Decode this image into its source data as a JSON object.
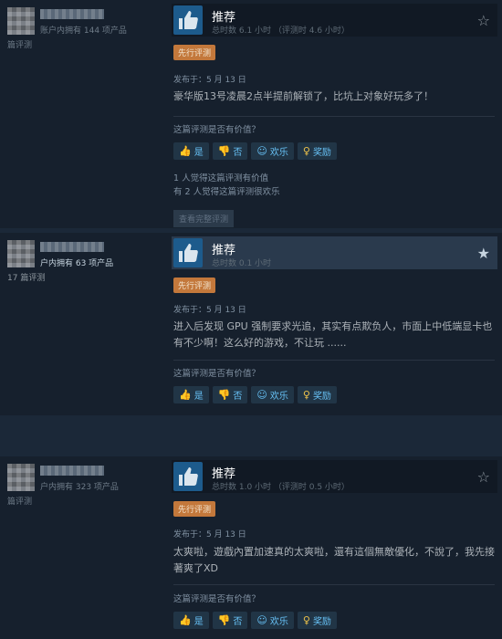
{
  "reviews": [
    {
      "products": "账户内拥有 144 项产品",
      "reviews_count": "篇评测",
      "title": "推荐",
      "hours": "总时数 6.1 小时 （评测时 4.6 小时）",
      "badge": "先行评测",
      "posted": "发布于：5 月 13 日",
      "body": "豪华版13号凌晨2点半提前解锁了，比坑上对象好玩多了！",
      "helpful_question": "这篇评测是否有价值？",
      "stats": [
        "1 人觉得这篇评测有价值",
        "有 2 人觉得这篇评测很欢乐"
      ],
      "read_more": "查看完整评测"
    },
    {
      "products": "户内拥有 63 项产品",
      "reviews_count": "17 篇评测",
      "title": "推荐",
      "hours": "总时数 0.1 小时",
      "badge": "先行评测",
      "posted": "发布于：5 月 13 日",
      "body": "进入后发现 GPU 强制要求光追，其实有点欺负人，市面上中低端显卡也有不少啊！这么好的游戏，不让玩 ......",
      "helpful_question": "这篇评测是否有价值？"
    },
    {
      "products": "户内拥有 323 项产品",
      "reviews_count": "篇评测",
      "title": "推荐",
      "hours": "总时数 1.0 小时 （评测时 0.5 小时）",
      "badge": "先行评测",
      "posted": "发布于：5 月 13 日",
      "body": "太爽啦，遊戲內置加速真的太爽啦，還有這個無敵優化，不說了，我先接著爽了XD",
      "helpful_question": "这篇评测是否有价值？"
    }
  ],
  "buttons": {
    "yes": "是",
    "no": "否",
    "funny": "欢乐",
    "award": "奖励"
  },
  "icons": {
    "thumb_badge": "thumbs-up-icon",
    "star": "star-icon",
    "yes": "thumbs-up-icon",
    "no": "thumbs-down-icon",
    "funny": "smiley-icon",
    "award": "award-icon"
  },
  "colors": {
    "background": "#1b2838",
    "review_bg": "#16202d",
    "thumb_badge": "#1d5b8c",
    "early_access": "#c3783b",
    "button_text": "#67c1f5"
  }
}
